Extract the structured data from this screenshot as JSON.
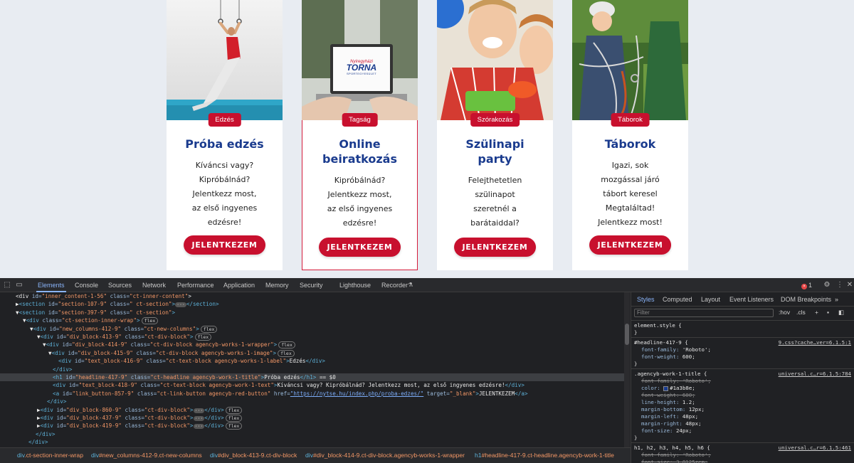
{
  "site": {
    "cards": [
      {
        "badge": "Edzés",
        "title": "Próba edzés",
        "text": [
          "Kíváncsi vagy?",
          "Kipróbálnád?",
          "Jelentkezz most,",
          "az első ingyenes",
          "edzésre!"
        ],
        "cta": "JELENTKEZEM"
      },
      {
        "badge": "Tagság",
        "title": "Online beiratkozás",
        "text": [
          "Kipróbálnád?",
          "Jelentkezz most,",
          "az első ingyenes",
          "edzésre!"
        ],
        "cta": "JELENTKEZEM",
        "logo_line1": "Nyíregyházi",
        "logo_line2": "TORNA",
        "logo_line3": "SPORTEGYESÜLET"
      },
      {
        "badge": "Szórakozás",
        "title": "Szülinapi party",
        "text": [
          "Felejthetetlen",
          "szülinapot",
          "szeretnél a",
          "barátaiddal?"
        ],
        "cta": "JELENTKEZEM"
      },
      {
        "badge": "Táborok",
        "title": "Táborok",
        "text": [
          "Igazi, sok",
          "mozgással járó",
          "tábort keresel",
          "Megtaláltad!",
          "Jelentkezz most!"
        ],
        "cta": "JELENTKEZEM"
      }
    ]
  },
  "devtools": {
    "tabs": [
      "Elements",
      "Console",
      "Sources",
      "Network",
      "Performance",
      "Application",
      "Memory",
      "Security",
      "Lighthouse",
      "Recorder"
    ],
    "error_count": "1",
    "dom_lines": [
      {
        "ind": 22,
        "parts": [
          [
            "tx",
            "<div "
          ],
          [
            "an",
            "id="
          ],
          [
            "av",
            "\"inner_content-1-56\""
          ],
          [
            "an",
            " class="
          ],
          [
            "av",
            "\"ct-inner-content\""
          ],
          [
            "tx",
            ">"
          ]
        ]
      },
      {
        "ind": 22,
        "parts": [
          [
            "tx",
            "▶"
          ],
          [
            "tg",
            "<section "
          ],
          [
            "an",
            "id="
          ],
          [
            "av",
            "\"section-107-9\""
          ],
          [
            "an",
            " class="
          ],
          [
            "av",
            "\" ct-section\""
          ],
          [
            "tg",
            ">"
          ],
          [
            "dots",
            "···"
          ],
          [
            "tg",
            "</section>"
          ]
        ]
      },
      {
        "ind": 22,
        "parts": [
          [
            "tx",
            "▼"
          ],
          [
            "tg",
            "<section "
          ],
          [
            "an",
            "id="
          ],
          [
            "av",
            "\"section-397-9\""
          ],
          [
            "an",
            " class="
          ],
          [
            "av",
            "\" ct-section\""
          ],
          [
            "tg",
            ">"
          ]
        ]
      },
      {
        "ind": 32,
        "parts": [
          [
            "tx",
            "▼"
          ],
          [
            "tg",
            "<div "
          ],
          [
            "an",
            "class="
          ],
          [
            "av",
            "\"ct-section-inner-wrap\""
          ],
          [
            "tg",
            ">"
          ],
          [
            "flex",
            "flex"
          ]
        ]
      },
      {
        "ind": 42,
        "parts": [
          [
            "tx",
            "▼"
          ],
          [
            "tg",
            "<div "
          ],
          [
            "an",
            "id="
          ],
          [
            "av",
            "\"new_columns-412-9\""
          ],
          [
            "an",
            " class="
          ],
          [
            "av",
            "\"ct-new-columns\""
          ],
          [
            "tg",
            ">"
          ],
          [
            "flex",
            "flex"
          ]
        ]
      },
      {
        "ind": 52,
        "parts": [
          [
            "tx",
            "▼"
          ],
          [
            "tg",
            "<div "
          ],
          [
            "an",
            "id="
          ],
          [
            "av",
            "\"div_block-413-9\""
          ],
          [
            "an",
            " class="
          ],
          [
            "av",
            "\"ct-div-block\""
          ],
          [
            "tg",
            ">"
          ],
          [
            "flex",
            "flex"
          ]
        ]
      },
      {
        "ind": 60,
        "parts": [
          [
            "tx",
            "▼"
          ],
          [
            "tg",
            "<div "
          ],
          [
            "an",
            "id="
          ],
          [
            "av",
            "\"div_block-414-9\""
          ],
          [
            "an",
            " class="
          ],
          [
            "av",
            "\"ct-div-block agencyb-works-1-wrapper\""
          ],
          [
            "tg",
            ">"
          ],
          [
            "flex",
            "flex"
          ]
        ]
      },
      {
        "ind": 68,
        "parts": [
          [
            "tx",
            "▼"
          ],
          [
            "tg",
            "<div "
          ],
          [
            "an",
            "id="
          ],
          [
            "av",
            "\"div_block-415-9\""
          ],
          [
            "an",
            " class="
          ],
          [
            "av",
            "\"ct-div-block agencyb-works-1-image\""
          ],
          [
            "tg",
            ">"
          ],
          [
            "flex",
            "flex"
          ]
        ]
      },
      {
        "ind": 82,
        "parts": [
          [
            "tg",
            "<div "
          ],
          [
            "an",
            "id="
          ],
          [
            "av",
            "\"text_block-416-9\""
          ],
          [
            "an",
            " class="
          ],
          [
            "av",
            "\"ct-text-block agencyb-works-1-label\""
          ],
          [
            "tg",
            ">"
          ],
          [
            "tx",
            "Edzés"
          ],
          [
            "tg",
            "</div>"
          ]
        ]
      },
      {
        "ind": 74,
        "parts": [
          [
            "tg",
            "</div>"
          ]
        ]
      },
      {
        "ind": 74,
        "sel": true,
        "parts": [
          [
            "tg",
            "<h1 "
          ],
          [
            "an",
            "id="
          ],
          [
            "av",
            "\"headline-417-9\""
          ],
          [
            "an",
            " class="
          ],
          [
            "av",
            "\"ct-headline agencyb-work-1-title\""
          ],
          [
            "tg",
            ">"
          ],
          [
            "tx",
            "Próba edzés"
          ],
          [
            "tg",
            "</h1>"
          ],
          [
            "tx",
            " == $0"
          ]
        ]
      },
      {
        "ind": 74,
        "parts": [
          [
            "tg",
            "<div "
          ],
          [
            "an",
            "id="
          ],
          [
            "av",
            "\"text_block-418-9\""
          ],
          [
            "an",
            " class="
          ],
          [
            "av",
            "\"ct-text-block agencyb-work-1-text\""
          ],
          [
            "tg",
            ">"
          ],
          [
            "tx",
            "Kíváncsi vagy? Kipróbálnád? Jelentkezz most, az első ingyenes edzésre!"
          ],
          [
            "tg",
            "</div>"
          ]
        ]
      },
      {
        "ind": 74,
        "parts": [
          [
            "tg",
            "<a "
          ],
          [
            "an",
            "id="
          ],
          [
            "av",
            "\"link_button-857-9\""
          ],
          [
            "an",
            " class="
          ],
          [
            "av",
            "\"ct-link-button agencyb-red-button\""
          ],
          [
            "an",
            " href="
          ],
          [
            "lnk",
            "\"https://nytse.hu/index.php/proba-edzes/\""
          ],
          [
            "an",
            " target="
          ],
          [
            "av",
            "\"_blank\""
          ],
          [
            "tg",
            ">"
          ],
          [
            "tx",
            "JELENTKEZEM"
          ],
          [
            "tg",
            "</a>"
          ]
        ]
      },
      {
        "ind": 66,
        "parts": [
          [
            "tg",
            "</div>"
          ]
        ]
      },
      {
        "ind": 52,
        "parts": [
          [
            "tx",
            "▶"
          ],
          [
            "tg",
            "<div "
          ],
          [
            "an",
            "id="
          ],
          [
            "av",
            "\"div_block-860-9\""
          ],
          [
            "an",
            " class="
          ],
          [
            "av",
            "\"ct-div-block\""
          ],
          [
            "tg",
            ">"
          ],
          [
            "dots",
            "···"
          ],
          [
            "tg",
            "</div>"
          ],
          [
            "flex",
            "flex"
          ]
        ]
      },
      {
        "ind": 52,
        "parts": [
          [
            "tx",
            "▶"
          ],
          [
            "tg",
            "<div "
          ],
          [
            "an",
            "id="
          ],
          [
            "av",
            "\"div_block-437-9\""
          ],
          [
            "an",
            " class="
          ],
          [
            "av",
            "\"ct-div-block\""
          ],
          [
            "tg",
            ">"
          ],
          [
            "dots",
            "···"
          ],
          [
            "tg",
            "</div>"
          ],
          [
            "flex",
            "flex"
          ]
        ]
      },
      {
        "ind": 52,
        "parts": [
          [
            "tx",
            "▶"
          ],
          [
            "tg",
            "<div "
          ],
          [
            "an",
            "id="
          ],
          [
            "av",
            "\"div_block-419-9\""
          ],
          [
            "an",
            " class="
          ],
          [
            "av",
            "\"ct-div-block\""
          ],
          [
            "tg",
            ">"
          ],
          [
            "dots",
            "···"
          ],
          [
            "tg",
            "</div>"
          ],
          [
            "flex",
            "flex"
          ]
        ]
      },
      {
        "ind": 50,
        "parts": [
          [
            "tg",
            "</div>"
          ]
        ]
      },
      {
        "ind": 40,
        "parts": [
          [
            "tg",
            "</div>"
          ]
        ]
      },
      {
        "ind": 32,
        "parts": [
          [
            "tg",
            "</section>"
          ]
        ]
      }
    ],
    "breadcrumbs": [
      {
        "a": "div",
        "b": ".ct-section-inner-wrap"
      },
      {
        "a": "div",
        "b": "#new_columns-412-9.ct-new-columns"
      },
      {
        "a": "div",
        "b": "#div_block-413-9.ct-div-block"
      },
      {
        "a": "div",
        "b": "#div_block-414-9.ct-div-block.agencyb-works-1-wrapper"
      },
      {
        "a": "h1",
        "b": "#headline-417-9.ct-headline.agencyb-work-1-title"
      }
    ],
    "styles_tabs": [
      "Styles",
      "Computed",
      "Layout",
      "Event Listeners",
      "DOM Breakpoints"
    ],
    "filter_placeholder": "Filter",
    "hov": ":hov",
    "cls": ".cls",
    "rules": [
      {
        "selector": "element.style {",
        "source": "",
        "props": []
      },
      {
        "selector": "#headline-417-9 {",
        "source": "9.css?cache…ver=6.1.5:1",
        "props": [
          [
            "font-family",
            "'Roboto';",
            false
          ],
          [
            "font-weight",
            "600;",
            false
          ]
        ]
      },
      {
        "selector": ".agencyb-work-1-title {",
        "source": "universal.c…r=6.1.5:784",
        "props": [
          [
            "font-family",
            "'Roboto';",
            true
          ],
          [
            "color",
            "#1a3b8e;",
            false
          ],
          [
            "font-weight",
            "600;",
            true
          ],
          [
            "line-height",
            "1.2;",
            false
          ],
          [
            "margin-bottom",
            "12px;",
            false
          ],
          [
            "margin-left",
            "48px;",
            false
          ],
          [
            "margin-right",
            "48px;",
            false
          ],
          [
            "font-size",
            "24px;",
            false
          ]
        ]
      },
      {
        "selector": "h1, h2, h3, h4, h5, h6 {",
        "source": "universal.c…r=6.1.5:461",
        "props": [
          [
            "font-family",
            "'Roboto';",
            true
          ],
          [
            "font-size",
            "3.8125rem;",
            true
          ]
        ]
      }
    ]
  }
}
